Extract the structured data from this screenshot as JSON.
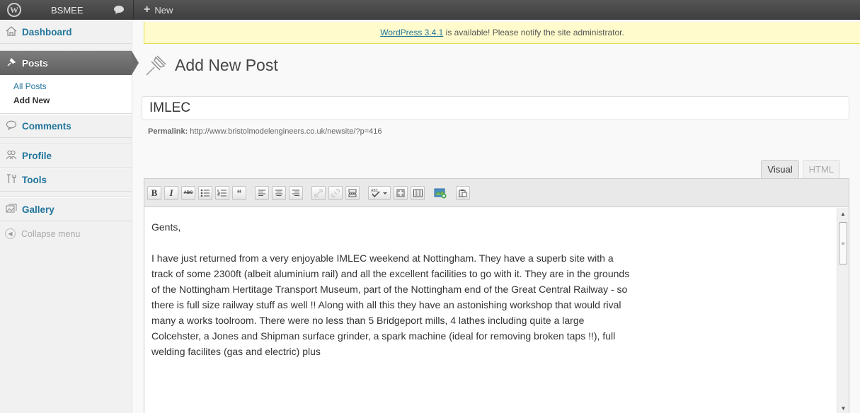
{
  "adminbar": {
    "logo_glyph": "W",
    "site_name": "BSMEE",
    "new_label": "New"
  },
  "sidebar": {
    "dashboard": "Dashboard",
    "posts": "Posts",
    "posts_submenu": [
      "All Posts",
      "Add New"
    ],
    "comments": "Comments",
    "profile": "Profile",
    "tools": "Tools",
    "gallery": "Gallery",
    "collapse": "Collapse menu"
  },
  "notice": {
    "link": "WordPress 3.4.1",
    "text": " is available! Please notify the site administrator."
  },
  "page": {
    "title": "Add New Post"
  },
  "post": {
    "title": "IMLEC",
    "permalink_label": "Permalink:",
    "permalink_url": " http://www.bristolmodelengineers.co.uk/newsite/?p=416"
  },
  "editor": {
    "tab_visual": "Visual",
    "tab_html": "HTML",
    "toolbar": [
      "bold",
      "italic",
      "strikethrough",
      "bullet-list",
      "numbered-list",
      "blockquote",
      "align-left",
      "align-center",
      "align-right",
      "insert-link",
      "unlink",
      "insert-more",
      "spellcheck",
      "fullscreen",
      "kitchen-sink",
      "add-media",
      "paste-word"
    ],
    "greeting": "Gents,",
    "body": "I have just returned from a very enjoyable IMLEC weekend at Nottingham. They have a superb site with a track of some 2300ft (albeit aluminium rail) and all the excellent facilities to go with it. They are in the grounds of the Nottingham Hertitage Transport Museum, part of the Nottingham end of the Great Central Railway - so there is full size railway stuff as well !! Along with all this they have an astonishing workshop that would rival many a works toolroom. There were no less than 5 Bridgeport mills, 4 lathes including quite a large Colcehster, a Jones and Shipman surface grinder, a spark machine (ideal for removing broken taps !!), full welding facilites (gas and electric) plus"
  },
  "colors": {
    "link": "#21759b",
    "adminbar": "#464646",
    "notice_bg": "#fffbcc"
  }
}
